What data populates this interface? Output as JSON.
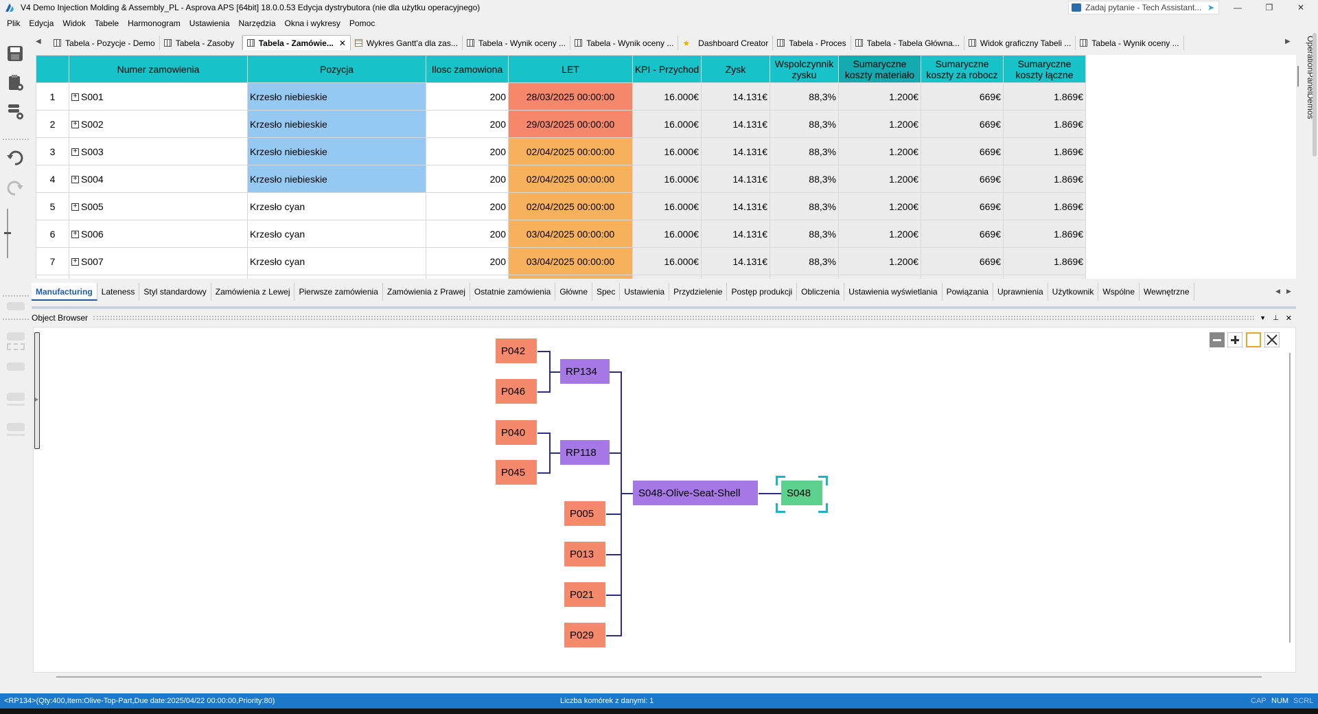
{
  "window": {
    "title": "V4 Demo Injection Molding & Assembly_PL - Asprova APS [64bit] 18.0.0.53 Edycja dystrybutora (nie dla użytku operacyjnego)",
    "ask_placeholder": "Zadaj pytanie - Tech Assistant...",
    "minimize_glyph": "—",
    "restore_glyph": "❐",
    "close_glyph": "✕"
  },
  "menu": [
    "Plik",
    "Edycja",
    "Widok",
    "Tabele",
    "Harmonogram",
    "Ustawienia",
    "Narzędzia",
    "Okna i wykresy",
    "Pomoc"
  ],
  "doc_tabs": [
    {
      "label": "Tabela - Pozycje - Demo",
      "icon": "table-icon"
    },
    {
      "label": "Tabela - Zasoby",
      "icon": "table-icon"
    },
    {
      "label": "Tabela - Zamówie...",
      "icon": "table-icon",
      "active": true
    },
    {
      "label": "Wykres Gantt'a dla zas...",
      "icon": "gantt-icon"
    },
    {
      "label": "Tabela - Wynik oceny ...",
      "icon": "table-icon"
    },
    {
      "label": "Tabela - Wynik oceny ...",
      "icon": "table-icon"
    },
    {
      "label": "Dashboard Creator",
      "icon": "star-icon"
    },
    {
      "label": "Tabela - Proces",
      "icon": "table-icon"
    },
    {
      "label": "Tabela - Tabela Główna...",
      "icon": "table-icon"
    },
    {
      "label": "Widok graficzny Tabeli ...",
      "icon": "table-icon"
    },
    {
      "label": "Tabela - Wynik oceny ...",
      "icon": "table-icon"
    }
  ],
  "grid": {
    "headers": [
      "",
      "Numer zamowienia",
      "Pozycja",
      "Ilosc zamowiona",
      "LET",
      "KPI - Przychod",
      "Zysk",
      "Wspolczynnik zysku",
      "Sumaryczne koszty materiało",
      "Sumaryczne koszty za robocz",
      "Sumaryczne koszty łączne"
    ],
    "rows": [
      {
        "n": "1",
        "order": "S001",
        "item": "Krzesło niebieskie",
        "qty": "200",
        "let": "28/03/2025 00:00:00",
        "let_status": "red",
        "rev": "16.000€",
        "profit": "14.131€",
        "ratio": "88,3%",
        "mat": "1.200€",
        "labor": "669€",
        "total": "1.869€"
      },
      {
        "n": "2",
        "order": "S002",
        "item": "Krzesło niebieskie",
        "qty": "200",
        "let": "29/03/2025 00:00:00",
        "let_status": "red",
        "rev": "16.000€",
        "profit": "14.131€",
        "ratio": "88,3%",
        "mat": "1.200€",
        "labor": "669€",
        "total": "1.869€"
      },
      {
        "n": "3",
        "order": "S003",
        "item": "Krzesło niebieskie",
        "qty": "200",
        "let": "02/04/2025 00:00:00",
        "let_status": "orange",
        "rev": "16.000€",
        "profit": "14.131€",
        "ratio": "88,3%",
        "mat": "1.200€",
        "labor": "669€",
        "total": "1.869€"
      },
      {
        "n": "4",
        "order": "S004",
        "item": "Krzesło niebieskie",
        "qty": "200",
        "let": "02/04/2025 00:00:00",
        "let_status": "orange",
        "rev": "16.000€",
        "profit": "14.131€",
        "ratio": "88,3%",
        "mat": "1.200€",
        "labor": "669€",
        "total": "1.869€"
      },
      {
        "n": "5",
        "order": "S005",
        "item": "Krzesło cyan",
        "qty": "200",
        "let": "02/04/2025 00:00:00",
        "let_status": "orange",
        "rev": "16.000€",
        "profit": "14.131€",
        "ratio": "88,3%",
        "mat": "1.200€",
        "labor": "669€",
        "total": "1.869€"
      },
      {
        "n": "6",
        "order": "S006",
        "item": "Krzesło cyan",
        "qty": "200",
        "let": "03/04/2025 00:00:00",
        "let_status": "orange",
        "rev": "16.000€",
        "profit": "14.131€",
        "ratio": "88,3%",
        "mat": "1.200€",
        "labor": "669€",
        "total": "1.869€"
      },
      {
        "n": "7",
        "order": "S007",
        "item": "Krzesło cyan",
        "qty": "200",
        "let": "03/04/2025 00:00:00",
        "let_status": "orange",
        "rev": "16.000€",
        "profit": "14.131€",
        "ratio": "88,3%",
        "mat": "1.200€",
        "labor": "669€",
        "total": "1.869€"
      }
    ]
  },
  "view_tabs": [
    "Manufacturing",
    "Lateness",
    "Styl standardowy",
    "Zamówienia z Lewej",
    "Pierwsze zamówienia",
    "Zamówienia z Prawej",
    "Ostatnie zamówienia",
    "Główne",
    "Spec",
    "Ustawienia",
    "Przydzielenie",
    "Postęp produkcji",
    "Obliczenia",
    "Ustawienia wyświetlania",
    "Powiązania",
    "Uprawnienia",
    "Użytkownik",
    "Wspólne",
    "Wewnętrzne"
  ],
  "object_browser": {
    "title": "Object Browser",
    "nodes": {
      "p042": "P042",
      "p046": "P046",
      "rp134": "RP134",
      "p040": "P040",
      "p045": "P045",
      "rp118": "RP118",
      "p005": "P005",
      "p013": "P013",
      "p021": "P021",
      "p029": "P029",
      "shell": "S048-Olive-Seat-Shell",
      "final": "S048"
    }
  },
  "right_panel_label": "OperationPanelDemos",
  "status": {
    "left": "<RP134>(Qty:400,Item:Olive-Top-Part,Due date:2025/04/22 00:00:00,Priority:80)",
    "middle": "Liczba komórek z danymi: 1",
    "cap": "CAP",
    "num": "NUM",
    "scrl": "SCRL"
  },
  "colors": {
    "header": "#17c3c9",
    "late_red": "#f5886a",
    "late_orange": "#f7b15c",
    "item_blue": "#95c9f1",
    "part_node": "#f5896b",
    "rp_node": "#a678e6",
    "final_node": "#5dd28f",
    "status_bar": "#1c78c8"
  }
}
